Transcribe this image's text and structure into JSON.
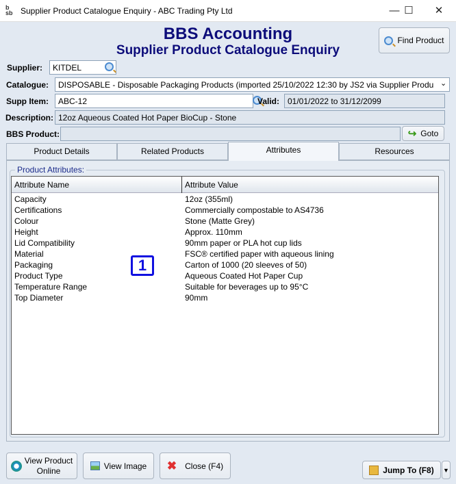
{
  "window": {
    "title": "Supplier Product Catalogue Enquiry - ABC Trading Pty Ltd",
    "icon": "bbs-logo-icon",
    "controls": {
      "minimize": "—",
      "maximize": "☐",
      "close": "✕"
    }
  },
  "header": {
    "title": "BBS Accounting",
    "subtitle": "Supplier Product Catalogue Enquiry",
    "find_product": "Find Product"
  },
  "form": {
    "supplier_label": "Supplier:",
    "supplier_value": "KITDEL",
    "catalogue_label": "Catalogue:",
    "catalogue_value": "DISPOSABLE - Disposable Packaging Products (imported 25/10/2022 12:30 by JS2 via Supplier Produ",
    "supp_item_label": "Supp Item:",
    "supp_item_value": "ABC-12",
    "valid_label": "Valid:",
    "valid_value": "01/01/2022 to 31/12/2099",
    "description_label": "Description:",
    "description_value": "12oz Aqueous Coated Hot Paper BioCup - Stone",
    "bbs_product_label": "BBS Product:",
    "bbs_product_value": "",
    "goto": "Goto"
  },
  "tabs": [
    {
      "label": "Product Details"
    },
    {
      "label": "Related Products"
    },
    {
      "label": "Attributes",
      "selected": true
    },
    {
      "label": "Resources"
    }
  ],
  "attributes": {
    "group_label": "Product Attributes:",
    "columns": [
      "Attribute Name",
      "Attribute Value"
    ],
    "rows": [
      [
        "Capacity",
        "12oz (355ml)"
      ],
      [
        "Certifications",
        "Commercially compostable to AS4736"
      ],
      [
        "Colour",
        "Stone (Matte Grey)"
      ],
      [
        "Height",
        "Approx. 110mm"
      ],
      [
        "Lid Compatibility",
        "90mm paper or PLA hot cup lids"
      ],
      [
        "Material",
        "FSC® certified paper with aqueous lining"
      ],
      [
        "Packaging",
        "Carton of 1000 (20 sleeves of 50)"
      ],
      [
        "Product Type",
        "Aqueous Coated Hot Paper Cup"
      ],
      [
        "Temperature Range",
        "Suitable for beverages up to 95°C"
      ],
      [
        "Top Diameter",
        "90mm"
      ]
    ]
  },
  "marker": "1",
  "footer": {
    "view_online_1": "View Product",
    "view_online_2": "Online",
    "view_image": "View Image",
    "close": "Close (F4)",
    "jump_to": "Jump To (F8)"
  }
}
